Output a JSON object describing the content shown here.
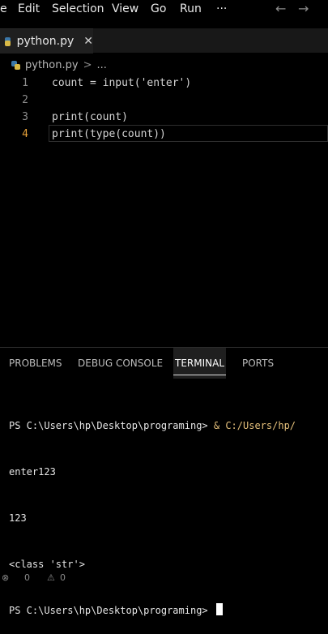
{
  "menubar": {
    "items": [
      "e",
      "Edit",
      "Selection",
      "View",
      "Go",
      "Run",
      "···"
    ],
    "back_icon": "arrow-left-icon",
    "forward_icon": "arrow-right-icon"
  },
  "tab": {
    "filename": "python.py",
    "icon": "python-file-icon",
    "close_glyph": "✕"
  },
  "breadcrumb": {
    "file": "python.py",
    "separator": ">",
    "rest": "..."
  },
  "editor": {
    "active_line": 4,
    "lines": [
      {
        "num": "1",
        "text": "count = input('enter')"
      },
      {
        "num": "2",
        "text": ""
      },
      {
        "num": "3",
        "text": "print(count)"
      },
      {
        "num": "4",
        "text": "print(type(count))"
      }
    ]
  },
  "panel": {
    "tabs": [
      "PROBLEMS",
      "DEBUG CONSOLE",
      "TERMINAL",
      "PORTS"
    ],
    "active_tab": "TERMINAL"
  },
  "terminal": {
    "prompt": "PS C:\\Users\\hp\\Desktop\\programing> ",
    "command": "& C:/Users/hp/",
    "output": [
      "enter123",
      "123",
      "<class 'str'>"
    ],
    "final_prompt": "PS C:\\Users\\hp\\Desktop\\programing> "
  },
  "statusbar": {
    "errors": "0",
    "warnings": "0"
  },
  "colors": {
    "line_number_active": "#e9a33a",
    "terminal_path": "#e5c07b"
  }
}
